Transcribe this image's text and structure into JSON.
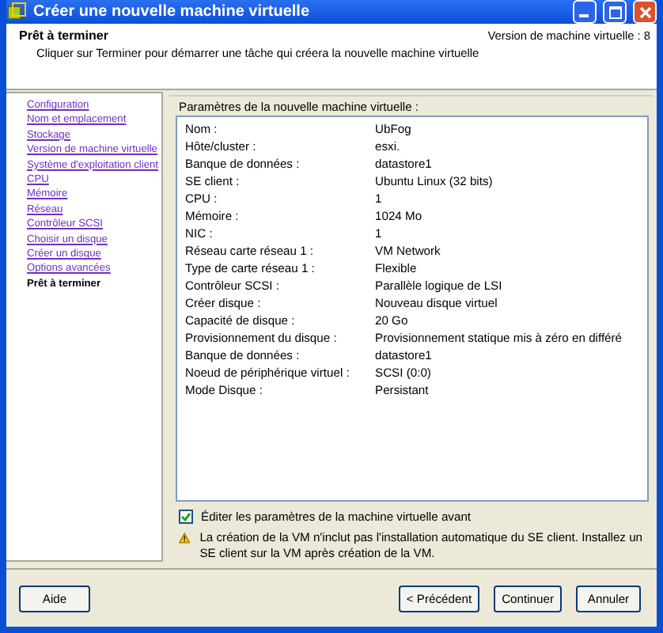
{
  "window": {
    "title": "Créer une nouvelle machine virtuelle"
  },
  "header": {
    "title": "Prêt à terminer",
    "subtitle": "Cliquer sur Terminer pour démarrer une tâche qui créera la nouvelle machine virtuelle",
    "version": "Version de machine virtuelle : 8"
  },
  "sidebar": {
    "items": [
      {
        "label": "Configuration",
        "selected": false
      },
      {
        "label": "Nom et emplacement",
        "selected": false
      },
      {
        "label": "Stockage",
        "selected": false
      },
      {
        "label": "Version de machine virtuelle",
        "selected": false
      },
      {
        "label": "Système d'exploitation client",
        "selected": false
      },
      {
        "label": "CPU",
        "selected": false
      },
      {
        "label": "Mémoire",
        "selected": false
      },
      {
        "label": "Réseau",
        "selected": false
      },
      {
        "label": "Contrôleur SCSI",
        "selected": false
      },
      {
        "label": "Choisir un disque",
        "selected": false
      },
      {
        "label": "Créer un disque",
        "selected": false
      },
      {
        "label": "Options avancées",
        "selected": false
      },
      {
        "label": "Prêt à terminer",
        "selected": true
      }
    ]
  },
  "settings": {
    "title": "Paramètres de la nouvelle machine virtuelle :",
    "rows": [
      {
        "label": "Nom :",
        "value": "UbFog"
      },
      {
        "label": "Hôte/cluster :",
        "value": "esxi."
      },
      {
        "label": "Banque de données :",
        "value": "datastore1"
      },
      {
        "label": "SE client :",
        "value": "Ubuntu Linux (32 bits)"
      },
      {
        "label": "CPU :",
        "value": "1"
      },
      {
        "label": "Mémoire :",
        "value": "1024 Mo"
      },
      {
        "label": "NIC :",
        "value": "1"
      },
      {
        "label": "Réseau carte réseau 1 :",
        "value": "VM Network"
      },
      {
        "label": "Type de carte réseau 1 :",
        "value": "Flexible"
      },
      {
        "label": "Contrôleur SCSI :",
        "value": "Parallèle logique de LSI"
      },
      {
        "label": "Créer disque :",
        "value": "Nouveau disque virtuel"
      },
      {
        "label": "Capacité de disque :",
        "value": "20 Go"
      },
      {
        "label": "Provisionnement du disque :",
        "value": "Provisionnement statique mis à zéro en différé"
      },
      {
        "label": "Banque de données :",
        "value": "datastore1"
      },
      {
        "label": "Noeud de périphérique virtuel :",
        "value": "SCSI (0:0)"
      },
      {
        "label": "Mode Disque :",
        "value": "Persistant"
      }
    ],
    "edit_checkbox": {
      "label": "Éditer les paramètres de la machine virtuelle avant",
      "checked": true
    },
    "warning": "La création de la VM n'inclut pas l'installation automatique du SE client. Installez un SE client sur la VM après création de la VM."
  },
  "buttons": {
    "help": "Aide",
    "back": "< Précédent",
    "next": "Continuer",
    "cancel": "Annuler"
  }
}
